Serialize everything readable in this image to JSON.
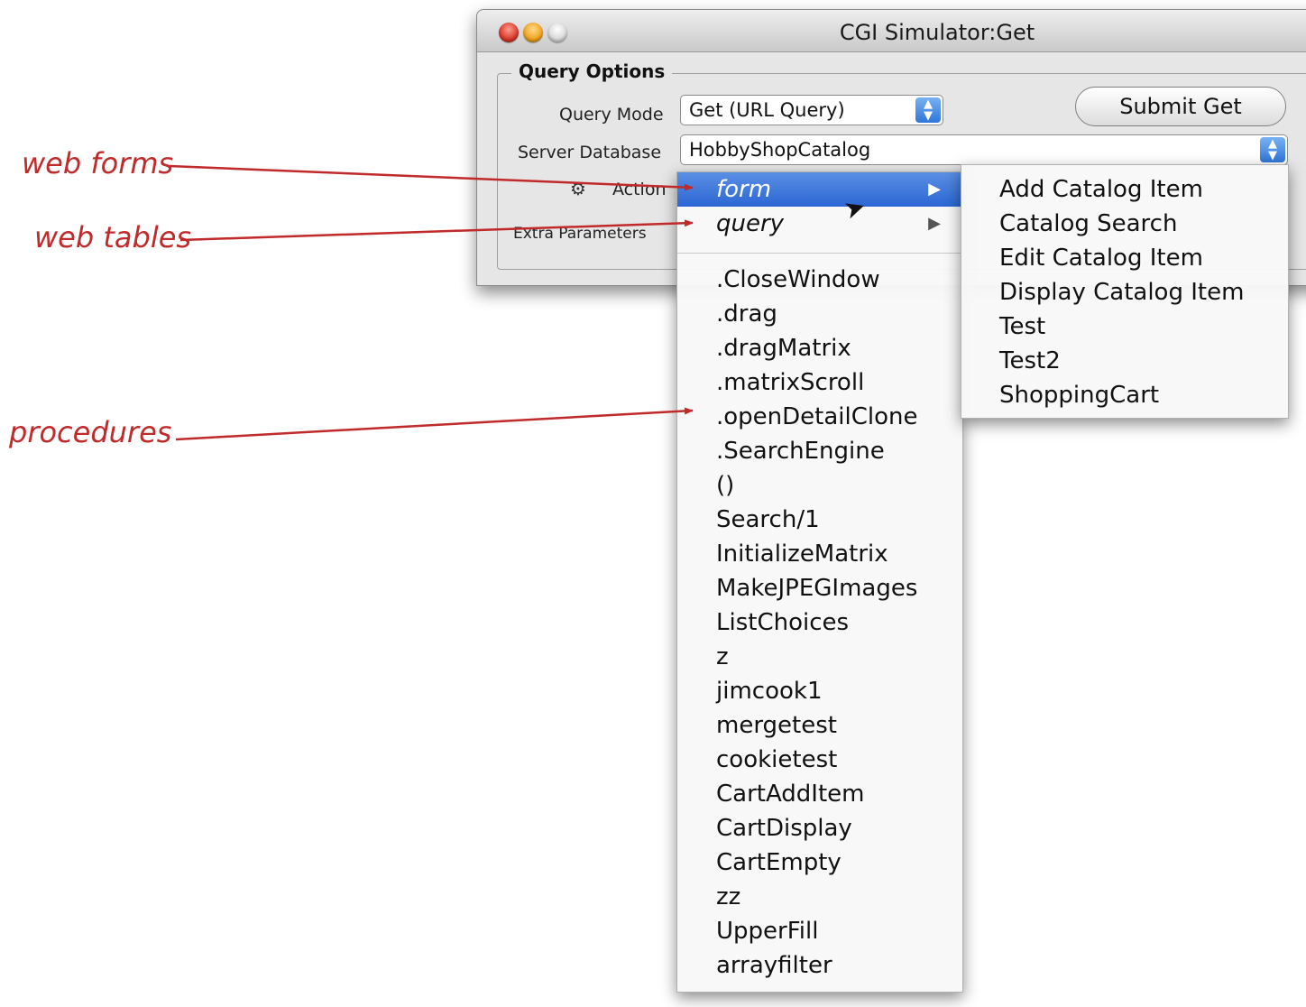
{
  "window": {
    "title": "CGI Simulator:Get",
    "group_title": "Query Options",
    "query_mode_label": "Query Mode",
    "query_mode_value": "Get (URL Query)",
    "server_db_label": "Server Database",
    "server_db_value": "HobbyShopCatalog",
    "action_label": "Action",
    "extra_params_label": "Extra Parameters",
    "submit_label": "Submit Get"
  },
  "annotations": {
    "web_forms": "web forms",
    "web_tables": "web tables",
    "procedures": "procedures"
  },
  "menu": {
    "form": "form",
    "query": "query",
    "procedures": [
      ".CloseWindow",
      ".drag",
      ".dragMatrix",
      ".matrixScroll",
      ".openDetailClone",
      ".SearchEngine",
      "()",
      "Search/1",
      "InitializeMatrix",
      "MakeJPEGImages",
      "ListChoices",
      "z",
      "jimcook1",
      "mergetest",
      "cookietest",
      "CartAddItem",
      "CartDisplay",
      "CartEmpty",
      "zz",
      "UpperFill",
      "arrayfilter"
    ]
  },
  "submenu": {
    "items": [
      "Add Catalog Item",
      "Catalog Search",
      "Edit Catalog Item",
      "Display Catalog Item",
      "Test",
      "Test2",
      "ShoppingCart"
    ]
  },
  "colors": {
    "annotation": "#c02a2a",
    "highlight": "#2c66d4"
  }
}
